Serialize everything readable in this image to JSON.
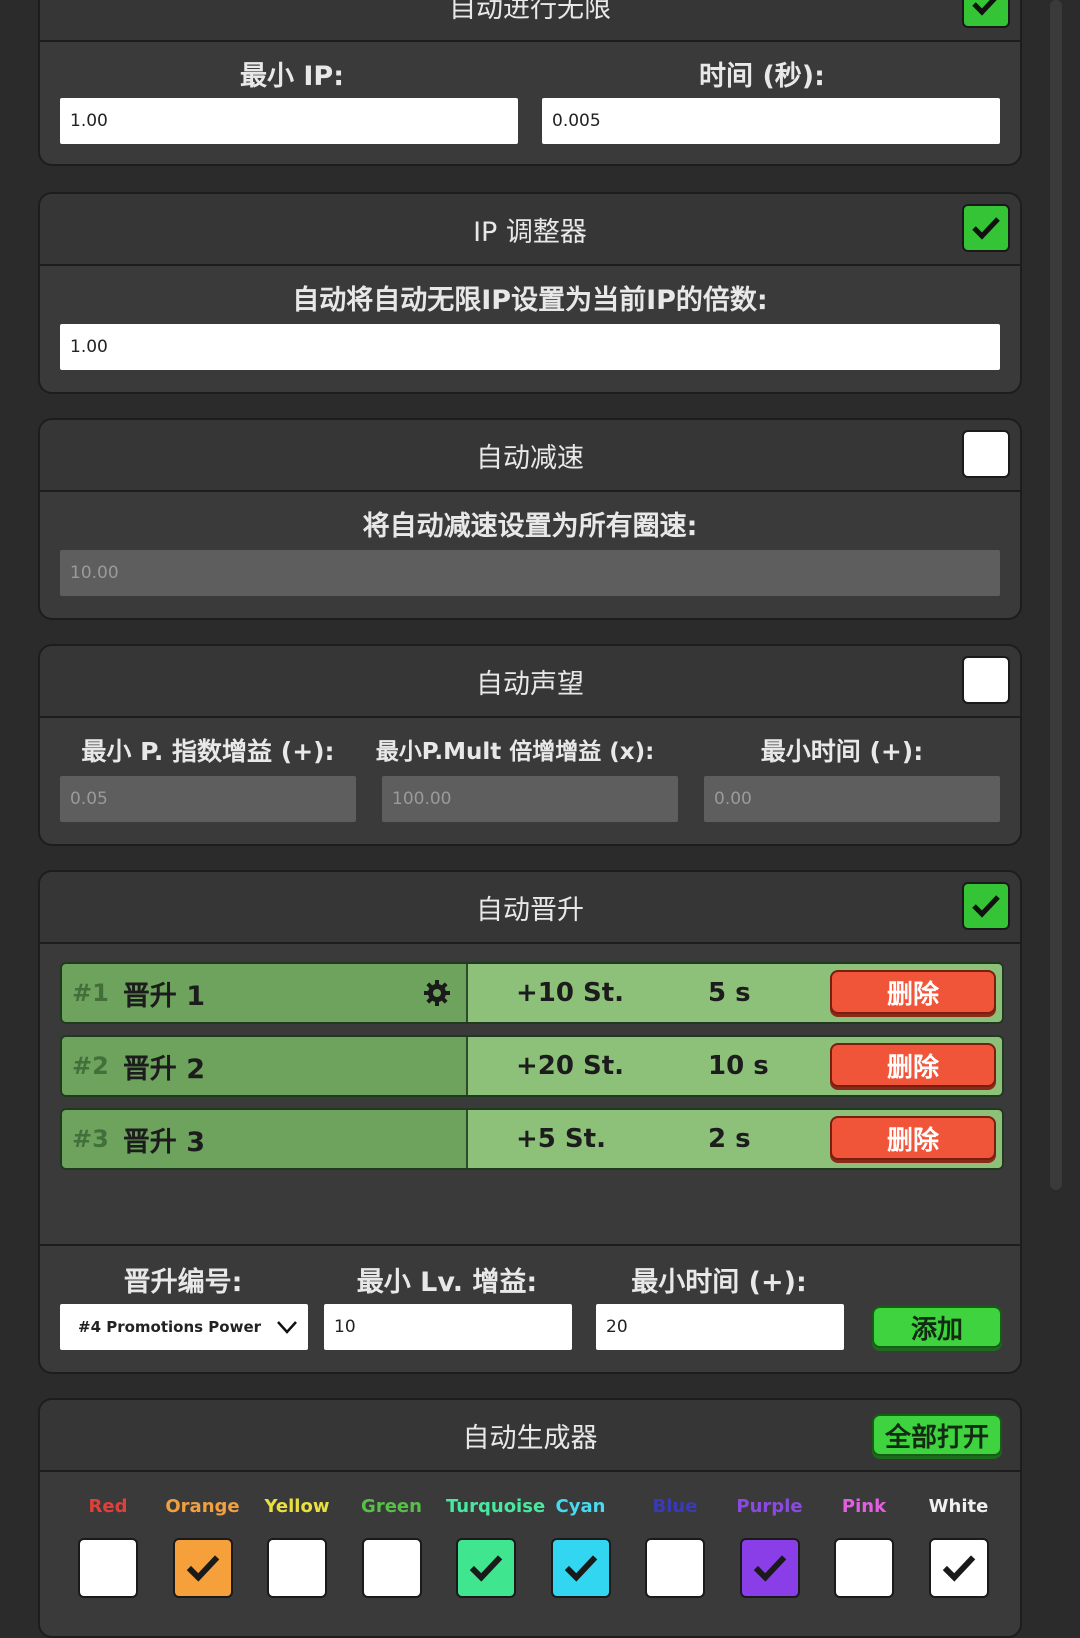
{
  "panel_autoinf": {
    "title": "自动进行无限",
    "enabled": true,
    "min_ip_label": "最小 IP:",
    "min_ip_value": "1.00",
    "time_label": "时间 (秒):",
    "time_value": "0.005"
  },
  "panel_ip": {
    "title": "IP 调整器",
    "enabled": true,
    "desc": "自动将自动无限IP设置为当前IP的倍数:",
    "value": "1.00"
  },
  "panel_slow": {
    "title": "自动减速",
    "enabled": false,
    "desc": "将自动减速设置为所有圈速:",
    "value": "10.00"
  },
  "panel_prestige": {
    "title": "自动声望",
    "enabled": false,
    "label1": "最小 P. 指数增益 (+):",
    "value1": "0.05",
    "label2": "最小P.Mult 倍增增益 (x):",
    "value2": "100.00",
    "label3": "最小时间 (+):",
    "value3": "0.00"
  },
  "panel_promo": {
    "title": "自动晋升",
    "enabled": true,
    "rows": [
      {
        "num": "#1",
        "name": "晋升 1",
        "st": "+10 St.",
        "time": "5 s",
        "delete": "删除"
      },
      {
        "num": "#2",
        "name": "晋升 2",
        "st": "+20 St.",
        "time": "10 s",
        "delete": "删除"
      },
      {
        "num": "#3",
        "name": "晋升 3",
        "st": "+5 St.",
        "time": "2 s",
        "delete": "删除"
      }
    ],
    "num_label": "晋升编号:",
    "num_select": "#4 Promotions Power",
    "lv_label": "最小 Lv. 增益:",
    "lv_value": "10",
    "time_label": "最小时间 (+):",
    "time_value": "20",
    "add": "添加"
  },
  "panel_gen": {
    "title": "自动生成器",
    "open_all": "全部打开",
    "colors": [
      {
        "name": "Red",
        "text_color": "#e0403a",
        "checked": false,
        "fill": "#ffffff"
      },
      {
        "name": "Orange",
        "text_color": "#f0a040",
        "checked": true,
        "fill": "#f5a03a"
      },
      {
        "name": "Yellow",
        "text_color": "#e8e040",
        "checked": false,
        "fill": "#ffffff"
      },
      {
        "name": "Green",
        "text_color": "#58c048",
        "checked": false,
        "fill": "#ffffff"
      },
      {
        "name": "Turquoise",
        "text_color": "#48e8a0",
        "checked": true,
        "fill": "#3fe58f"
      },
      {
        "name": "Cyan",
        "text_color": "#48d8f0",
        "checked": true,
        "fill": "#33d6f0"
      },
      {
        "name": "Blue",
        "text_color": "#3a3ab8",
        "checked": false,
        "fill": "#ffffff"
      },
      {
        "name": "Purple",
        "text_color": "#8a4ae0",
        "checked": true,
        "fill": "#8a3ee8"
      },
      {
        "name": "Pink",
        "text_color": "#e060e0",
        "checked": false,
        "fill": "#ffffff"
      },
      {
        "name": "White",
        "text_color": "#f0f0f0",
        "checked": true,
        "fill": "#ffffff"
      }
    ]
  }
}
